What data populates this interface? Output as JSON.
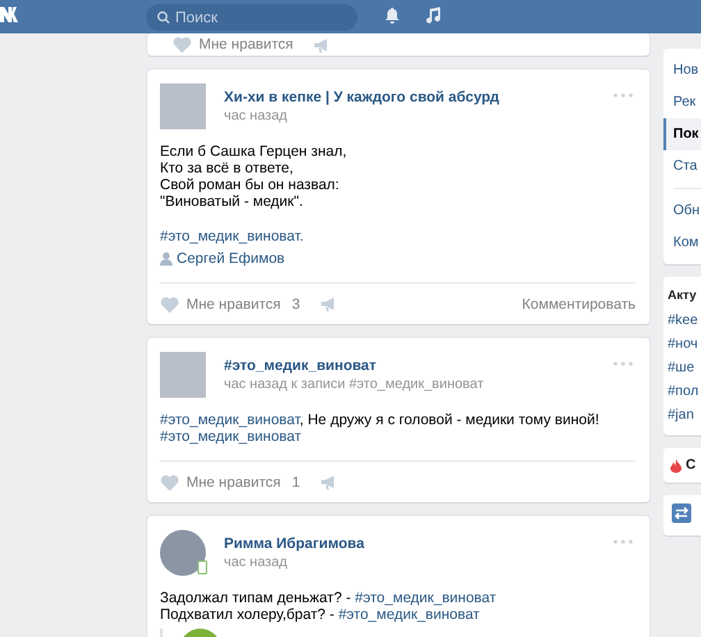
{
  "header": {
    "search": {
      "placeholder": "Поиск"
    }
  },
  "top_card": {
    "like_label": "Мне нравится"
  },
  "posts": [
    {
      "kind": "community",
      "author": "Хи-хи в кепке | У каждого свой абсурд",
      "time": "час назад",
      "online": false,
      "lines": [
        [
          {
            "kind": "text",
            "text": "Если б Сашка Герцен знал,"
          }
        ],
        [
          {
            "kind": "text",
            "text": "Кто за всё в ответе,"
          }
        ],
        [
          {
            "kind": "text",
            "text": "Свой роман бы он назвал:"
          }
        ],
        [
          {
            "kind": "text",
            "text": "\"Виноватый - медик\"."
          }
        ]
      ],
      "tag_line": "#это_медик_виноват.",
      "signer": "Сергей Ефимов",
      "like_label": "Мне нравится",
      "like_count": "3",
      "comment_label": "Комментировать"
    },
    {
      "kind": "community",
      "author": "#это_медик_виноват",
      "time": "час назад к записи #это_медик_виноват",
      "online": false,
      "lines": [
        [
          {
            "kind": "link",
            "text": "#это_медик_виноват"
          },
          {
            "kind": "text",
            "text": ", Не дружу я с головой - медики тому виной!"
          }
        ],
        [
          {
            "kind": "link",
            "text": "#это_медик_виноват"
          }
        ]
      ],
      "like_label": "Мне нравится",
      "like_count": "1"
    },
    {
      "kind": "user",
      "author": "Римма Ибрагимова",
      "time": "час назад",
      "online": true,
      "lines": [
        [
          {
            "kind": "text",
            "text": "Задолжал типам деньжат? - "
          },
          {
            "kind": "link",
            "text": "#это_медик_виноват"
          }
        ],
        [
          {
            "kind": "text",
            "text": "Подхватил холеру,брат? - "
          },
          {
            "kind": "link",
            "text": "#это_медик_виноват"
          }
        ]
      ],
      "repost": true
    }
  ],
  "menu": [
    [
      {
        "label": "Нов",
        "selected": false
      },
      {
        "label": "Рек",
        "selected": false
      },
      {
        "label": "Пок",
        "selected": true
      },
      {
        "label": "Ста",
        "selected": false
      }
    ],
    [
      {
        "label": "Обн",
        "selected": false
      },
      {
        "label": "Ком",
        "selected": false
      }
    ]
  ],
  "trends": {
    "title": "Акту",
    "tags": [
      "#kee",
      "#ноч",
      "#ше",
      "#пол",
      "#jan"
    ]
  },
  "hot": {
    "label": "С"
  }
}
